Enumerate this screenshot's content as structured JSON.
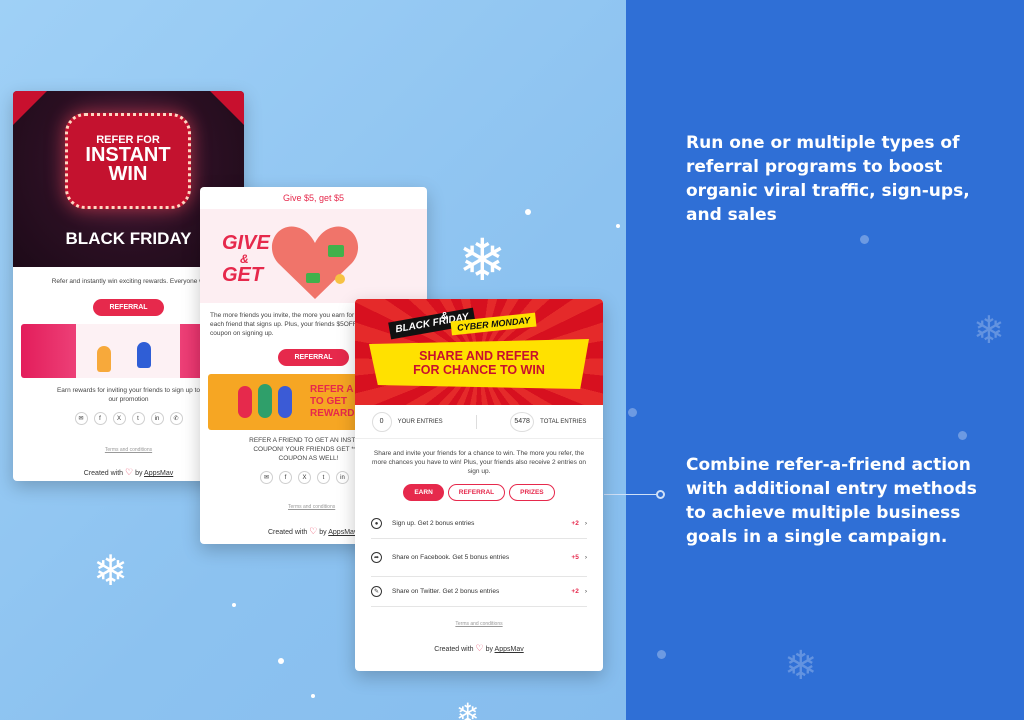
{
  "right_panel": {
    "headline": "Run one or multiple types of referral programs to boost organic viral traffic,  sign-ups, and sales",
    "body": "Combine refer-a-friend action with additional entry methods to achieve multiple business goals in a single campaign."
  },
  "card1": {
    "badge_top": "REFER FOR",
    "badge_big": "INSTANT WIN",
    "banner": "BLACK FRIDAY",
    "intro": "Refer and instantly win exciting rewards. Everyone wi",
    "button": "REFERRAL",
    "earn": "Earn rewards for inviting your friends to sign up to our promotion",
    "terms": "Terms and conditions",
    "created_with": "Created with",
    "by": "by",
    "brand": "AppsMav"
  },
  "card2": {
    "top": "Give $5, get $5",
    "hero_line1": "GIVE",
    "hero_line2": "&",
    "hero_line3": "GET",
    "intro": "The more friends you invite, the more you earn for each friend that signs up. Plus, your friends $5OFF coupon on signing up.",
    "button": "REFERRAL",
    "banner_line1": "REFER A",
    "banner_line2": "TO GET",
    "banner_line3": "REWARD",
    "body": "REFER A FRIEND TO GET AN INSTANT COUPON! YOUR FRIENDS GET **$5 COUPON AS WELL!",
    "terms": "Terms and conditions",
    "created_with": "Created with",
    "by": "by",
    "brand": "AppsMav"
  },
  "card3": {
    "tag_black": "BLACK FRIDAY",
    "amp": "&",
    "tag_cyber": "CYBER MONDAY",
    "headline_1": "SHARE AND REFER",
    "headline_2": "FOR CHANCE TO WIN",
    "your_entries_value": "0",
    "your_entries_label": "YOUR ENTRIES",
    "total_entries_value": "5478",
    "total_entries_label": "TOTAL ENTRIES",
    "intro": "Share and invite your friends for a chance to win. The more you refer, the more chances you have to win! Plus, your friends also receive 2 entries on sign up.",
    "tabs": [
      "EARN",
      "REFERRAL",
      "PRIZES"
    ],
    "actions": [
      {
        "label": "Sign up. Get 2 bonus entries",
        "points": "+2"
      },
      {
        "label": "Share on Facebook. Get 5 bonus entries",
        "points": "+5"
      },
      {
        "label": "Share on Twitter. Get 2 bonus entries",
        "points": "+2"
      }
    ],
    "terms": "Terms and conditions",
    "created_with": "Created with",
    "by": "by",
    "brand": "AppsMav"
  },
  "social_icons": [
    "email-icon",
    "facebook-icon",
    "x-icon",
    "tumblr-icon",
    "linkedin-icon",
    "whatsapp-icon"
  ],
  "colors": {
    "accent": "#e6294c",
    "right_bg": "#2f6fd6",
    "left_bg": "#93c6f1"
  }
}
